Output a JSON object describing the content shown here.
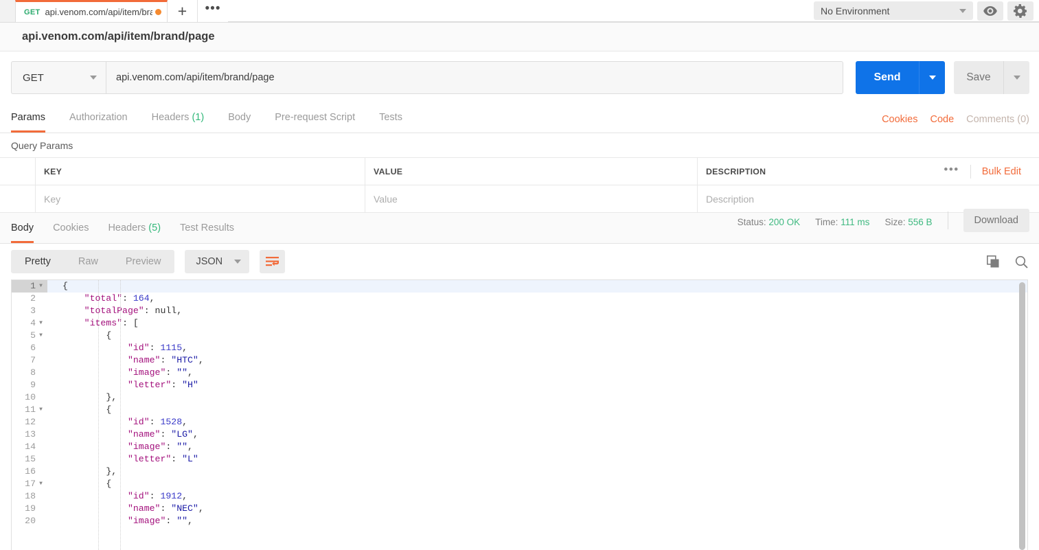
{
  "tab": {
    "method": "GET",
    "title": "api.venom.com/api/item/brand/",
    "unsaved_dot": "unsaved-changes-dot",
    "new_tab_label": "+",
    "more_label": "•••"
  },
  "environment": {
    "selected": "No Environment",
    "eye_icon": "eye-icon",
    "gear_icon": "gear-icon"
  },
  "request": {
    "title": "api.venom.com/api/item/brand/page",
    "method": "GET",
    "url": "api.venom.com/api/item/brand/page",
    "send_label": "Send",
    "save_label": "Save"
  },
  "request_tabs": [
    {
      "label": "Params",
      "count": "",
      "active": true
    },
    {
      "label": "Authorization",
      "count": "",
      "active": false
    },
    {
      "label": "Headers",
      "count": "(1)",
      "active": false
    },
    {
      "label": "Body",
      "count": "",
      "active": false
    },
    {
      "label": "Pre-request Script",
      "count": "",
      "active": false
    },
    {
      "label": "Tests",
      "count": "",
      "active": false
    }
  ],
  "request_tabs_right": {
    "cookies": "Cookies",
    "code": "Code",
    "comments": "Comments (0)"
  },
  "query_params": {
    "section_label": "Query Params",
    "headers": [
      "KEY",
      "VALUE",
      "DESCRIPTION"
    ],
    "row_placeholders": [
      "Key",
      "Value",
      "Description"
    ],
    "more_label": "•••",
    "bulk_edit_label": "Bulk Edit"
  },
  "response_tabs": [
    {
      "label": "Body",
      "count": "",
      "active": true
    },
    {
      "label": "Cookies",
      "count": "",
      "active": false
    },
    {
      "label": "Headers",
      "count": "(5)",
      "active": false
    },
    {
      "label": "Test Results",
      "count": "",
      "active": false
    }
  ],
  "response_meta": {
    "status_label": "Status:",
    "status_value": "200 OK",
    "time_label": "Time:",
    "time_value": "111 ms",
    "size_label": "Size:",
    "size_value": "556 B",
    "download_label": "Download"
  },
  "viewer_toolbar": {
    "modes": [
      "Pretty",
      "Raw",
      "Preview"
    ],
    "active_mode": "Pretty",
    "format": "JSON",
    "wrap_icon": "word-wrap-icon",
    "copy_icon": "copy-icon",
    "search_icon": "search-icon"
  },
  "colors": {
    "accent_orange": "#f26b3a",
    "send_blue": "#0f73e8",
    "status_green": "#3fb980",
    "method_green": "#2bab6e"
  },
  "response_body": {
    "language": "json",
    "lines": [
      {
        "num": 1,
        "fold": true,
        "indent": 0,
        "tokens": [
          {
            "t": "{",
            "c": "p"
          }
        ]
      },
      {
        "num": 2,
        "fold": false,
        "indent": 1,
        "tokens": [
          {
            "t": "\"total\"",
            "c": "k"
          },
          {
            "t": ": ",
            "c": "p"
          },
          {
            "t": "164",
            "c": "n"
          },
          {
            "t": ",",
            "c": "p"
          }
        ]
      },
      {
        "num": 3,
        "fold": false,
        "indent": 1,
        "tokens": [
          {
            "t": "\"totalPage\"",
            "c": "k"
          },
          {
            "t": ": ",
            "c": "p"
          },
          {
            "t": "null",
            "c": "p"
          },
          {
            "t": ",",
            "c": "p"
          }
        ]
      },
      {
        "num": 4,
        "fold": true,
        "indent": 1,
        "tokens": [
          {
            "t": "\"items\"",
            "c": "k"
          },
          {
            "t": ": [",
            "c": "p"
          }
        ]
      },
      {
        "num": 5,
        "fold": true,
        "indent": 2,
        "tokens": [
          {
            "t": "{",
            "c": "p"
          }
        ]
      },
      {
        "num": 6,
        "fold": false,
        "indent": 3,
        "tokens": [
          {
            "t": "\"id\"",
            "c": "k"
          },
          {
            "t": ": ",
            "c": "p"
          },
          {
            "t": "1115",
            "c": "n"
          },
          {
            "t": ",",
            "c": "p"
          }
        ]
      },
      {
        "num": 7,
        "fold": false,
        "indent": 3,
        "tokens": [
          {
            "t": "\"name\"",
            "c": "k"
          },
          {
            "t": ": ",
            "c": "p"
          },
          {
            "t": "\"HTC\"",
            "c": "s"
          },
          {
            "t": ",",
            "c": "p"
          }
        ]
      },
      {
        "num": 8,
        "fold": false,
        "indent": 3,
        "tokens": [
          {
            "t": "\"image\"",
            "c": "k"
          },
          {
            "t": ": ",
            "c": "p"
          },
          {
            "t": "\"\"",
            "c": "s"
          },
          {
            "t": ",",
            "c": "p"
          }
        ]
      },
      {
        "num": 9,
        "fold": false,
        "indent": 3,
        "tokens": [
          {
            "t": "\"letter\"",
            "c": "k"
          },
          {
            "t": ": ",
            "c": "p"
          },
          {
            "t": "\"H\"",
            "c": "s"
          }
        ]
      },
      {
        "num": 10,
        "fold": false,
        "indent": 2,
        "tokens": [
          {
            "t": "},",
            "c": "p"
          }
        ]
      },
      {
        "num": 11,
        "fold": true,
        "indent": 2,
        "tokens": [
          {
            "t": "{",
            "c": "p"
          }
        ]
      },
      {
        "num": 12,
        "fold": false,
        "indent": 3,
        "tokens": [
          {
            "t": "\"id\"",
            "c": "k"
          },
          {
            "t": ": ",
            "c": "p"
          },
          {
            "t": "1528",
            "c": "n"
          },
          {
            "t": ",",
            "c": "p"
          }
        ]
      },
      {
        "num": 13,
        "fold": false,
        "indent": 3,
        "tokens": [
          {
            "t": "\"name\"",
            "c": "k"
          },
          {
            "t": ": ",
            "c": "p"
          },
          {
            "t": "\"LG\"",
            "c": "s"
          },
          {
            "t": ",",
            "c": "p"
          }
        ]
      },
      {
        "num": 14,
        "fold": false,
        "indent": 3,
        "tokens": [
          {
            "t": "\"image\"",
            "c": "k"
          },
          {
            "t": ": ",
            "c": "p"
          },
          {
            "t": "\"\"",
            "c": "s"
          },
          {
            "t": ",",
            "c": "p"
          }
        ]
      },
      {
        "num": 15,
        "fold": false,
        "indent": 3,
        "tokens": [
          {
            "t": "\"letter\"",
            "c": "k"
          },
          {
            "t": ": ",
            "c": "p"
          },
          {
            "t": "\"L\"",
            "c": "s"
          }
        ]
      },
      {
        "num": 16,
        "fold": false,
        "indent": 2,
        "tokens": [
          {
            "t": "},",
            "c": "p"
          }
        ]
      },
      {
        "num": 17,
        "fold": true,
        "indent": 2,
        "tokens": [
          {
            "t": "{",
            "c": "p"
          }
        ]
      },
      {
        "num": 18,
        "fold": false,
        "indent": 3,
        "tokens": [
          {
            "t": "\"id\"",
            "c": "k"
          },
          {
            "t": ": ",
            "c": "p"
          },
          {
            "t": "1912",
            "c": "n"
          },
          {
            "t": ",",
            "c": "p"
          }
        ]
      },
      {
        "num": 19,
        "fold": false,
        "indent": 3,
        "tokens": [
          {
            "t": "\"name\"",
            "c": "k"
          },
          {
            "t": ": ",
            "c": "p"
          },
          {
            "t": "\"NEC\"",
            "c": "s"
          },
          {
            "t": ",",
            "c": "p"
          }
        ]
      },
      {
        "num": 20,
        "fold": false,
        "indent": 3,
        "tokens": [
          {
            "t": "\"image\"",
            "c": "k"
          },
          {
            "t": ": ",
            "c": "p"
          },
          {
            "t": "\"\"",
            "c": "s"
          },
          {
            "t": ",",
            "c": "p"
          }
        ]
      }
    ]
  }
}
